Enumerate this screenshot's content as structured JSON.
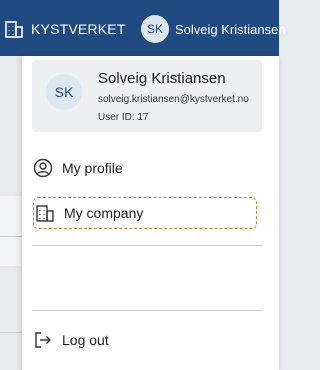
{
  "topbar": {
    "company_name": "KYSTVERKET",
    "avatar_initials": "SK",
    "user_name": "Solveig Kristiansen"
  },
  "user_card": {
    "initials": "SK",
    "name": "Solveig Kristiansen",
    "email": "solveig.kristiansen@kystverket.no",
    "user_id": "User ID: 17"
  },
  "menu": {
    "profile_label": "My profile",
    "company_label": "My company",
    "logout_label": "Log out"
  },
  "colors": {
    "topbar": "#1f4a82",
    "highlight": "#e07b35"
  },
  "icons": {
    "company": "building-icon",
    "profile": "user-circle-icon",
    "logout": "logout-icon"
  }
}
